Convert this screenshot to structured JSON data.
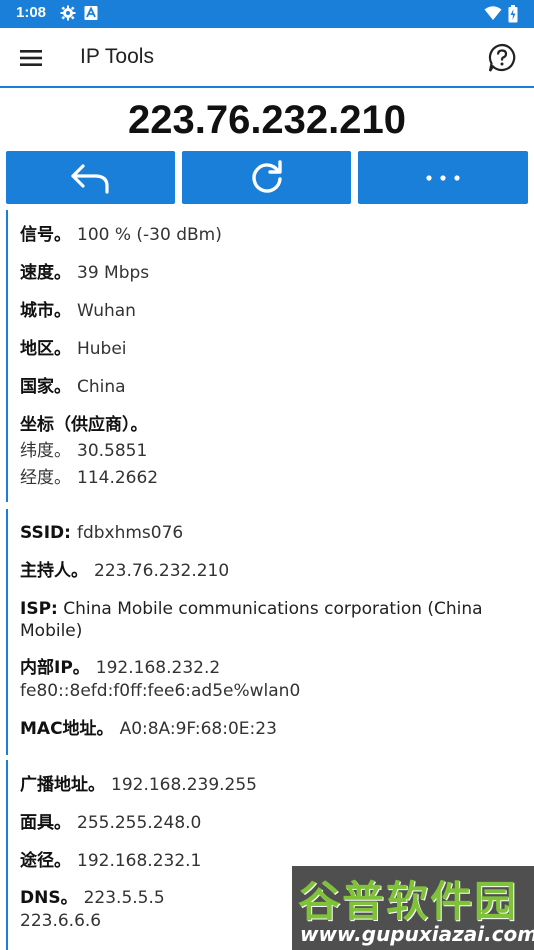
{
  "status_bar": {
    "time": "1:08",
    "icons": [
      "gear-icon",
      "a-icon",
      "wifi-icon",
      "battery-icon"
    ]
  },
  "app_bar": {
    "title": "IP Tools",
    "menu_icon": "hamburger-icon",
    "help_icon": "help-circle-icon"
  },
  "ip_address": "223.76.232.210",
  "actions": [
    {
      "icon": "back-arrow-icon"
    },
    {
      "icon": "refresh-icon"
    },
    {
      "icon": "more-horizontal-icon"
    }
  ],
  "section1": {
    "signal": {
      "label": "信号。",
      "value": "100 % (-30 dBm)"
    },
    "speed": {
      "label": "速度。",
      "value": "39 Mbps"
    },
    "city": {
      "label": "城市。",
      "value": "Wuhan"
    },
    "region": {
      "label": "地区。",
      "value": "Hubei"
    },
    "country": {
      "label": "国家。",
      "value": "China"
    },
    "coords": {
      "label": "坐标（供应商）。",
      "lat_label": "纬度。",
      "lat_value": "30.5851",
      "lon_label": "经度。",
      "lon_value": "114.2662"
    }
  },
  "section2": {
    "ssid": {
      "label": "SSID:",
      "value": "fdbxhms076"
    },
    "host": {
      "label": "主持人。",
      "value": "223.76.232.210"
    },
    "isp": {
      "label": "ISP:",
      "value": "China Mobile communications corporation (China Mobile)"
    },
    "internal_ip": {
      "label": "内部IP。",
      "value": "192.168.232.2",
      "ipv6": "fe80::8efd:f0ff:fee6:ad5e%wlan0"
    },
    "mac": {
      "label": "MAC地址。",
      "value": "A0:8A:9F:68:0E:23"
    }
  },
  "section3": {
    "broadcast": {
      "label": "广播地址。",
      "value": "192.168.239.255"
    },
    "mask": {
      "label": "面具。",
      "value": "255.255.248.0"
    },
    "gateway": {
      "label": "途径。",
      "value": "192.168.232.1"
    },
    "dns": {
      "label": "DNS。",
      "value": "223.5.5.5",
      "value2": "223.6.6.6"
    }
  },
  "watermark": {
    "text": "谷普软件园",
    "url": "www.gupuxiazai.com"
  },
  "colors": {
    "primary": "#1a7fd9",
    "watermark_green": "#7fc23a"
  }
}
